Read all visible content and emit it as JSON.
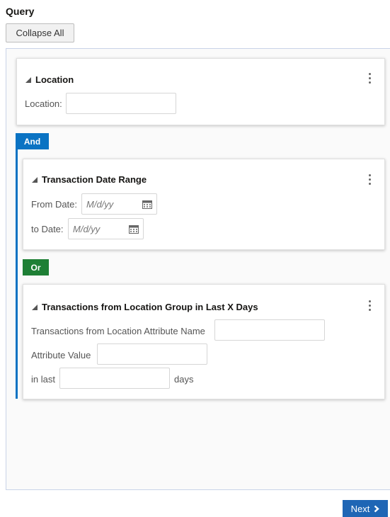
{
  "header": {
    "title": "Query",
    "collapse_label": "Collapse All"
  },
  "groups": [
    {
      "title": "Location",
      "fields": [
        {
          "label": "Location:",
          "value": ""
        }
      ]
    },
    {
      "operator": "And",
      "title": "Transaction Date Range",
      "fields": [
        {
          "label": "From Date:",
          "placeholder": "M/d/yy"
        },
        {
          "label": "to Date:",
          "placeholder": "M/d/yy"
        }
      ]
    },
    {
      "operator": "Or",
      "title": "Transactions from Location Group in Last X Days",
      "fields": [
        {
          "label": "Transactions from Location Attribute Name",
          "value": ""
        },
        {
          "label": "Attribute Value",
          "value": ""
        },
        {
          "label": "in last",
          "value": "",
          "suffix": "days"
        }
      ]
    }
  ],
  "footer": {
    "next_label": "Next"
  },
  "icons": {
    "expand": "triangle-down-icon",
    "menu": "kebab-icon",
    "calendar": "calendar-icon",
    "next": "chevron-right-icon"
  },
  "colors": {
    "and_badge": "#0a73c3",
    "or_badge": "#1e7f35",
    "next_button": "#1f66b5",
    "border_accent": "#0a73c3"
  }
}
